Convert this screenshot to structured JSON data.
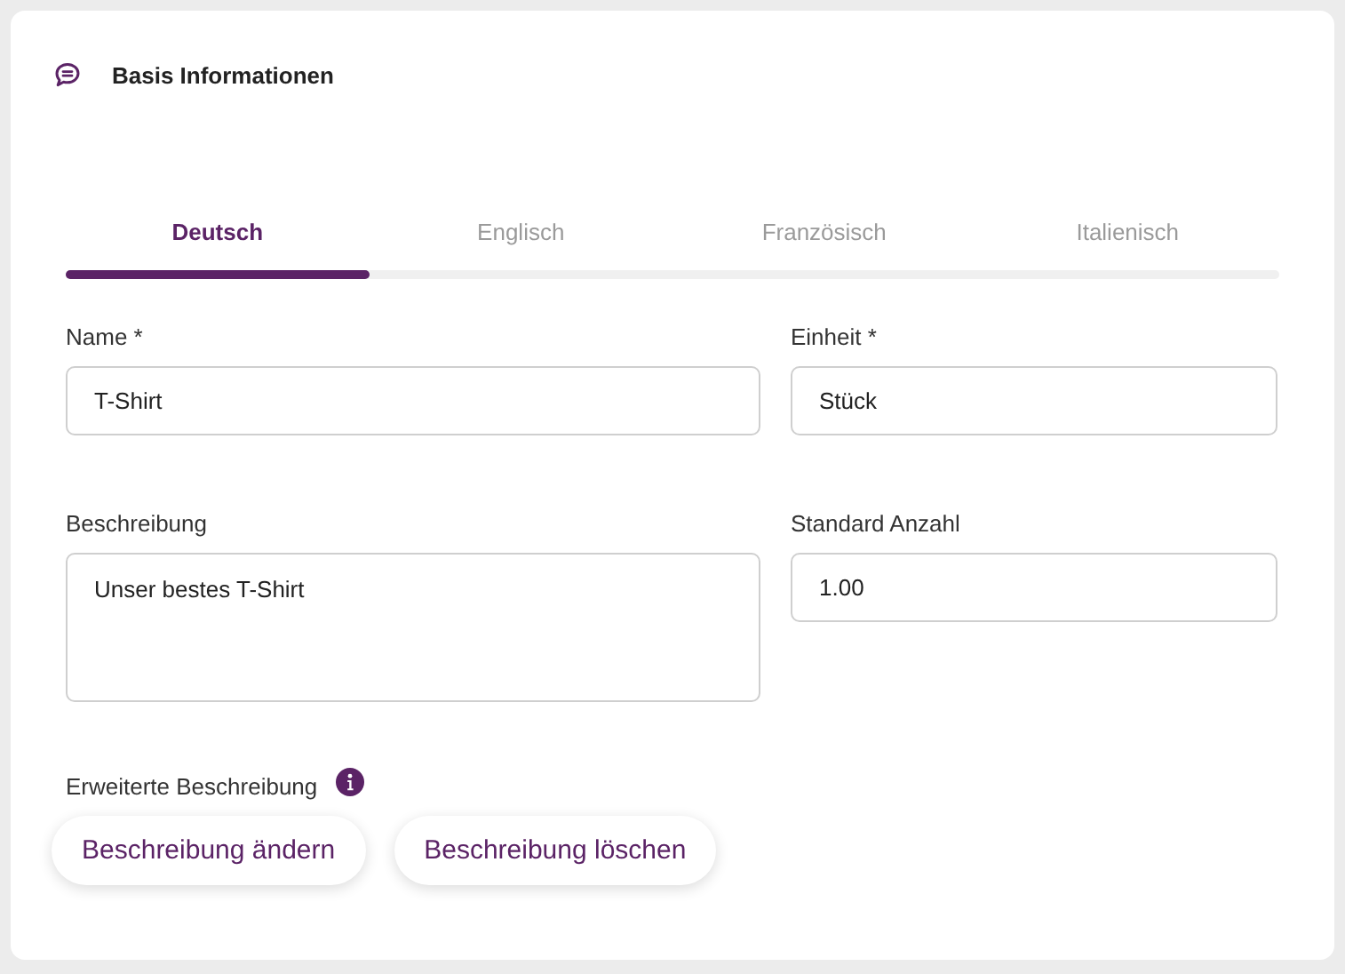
{
  "header": {
    "title": "Basis Informationen"
  },
  "tabs": [
    {
      "label": "Deutsch",
      "selected": true
    },
    {
      "label": "Englisch",
      "selected": false
    },
    {
      "label": "Französisch",
      "selected": false
    },
    {
      "label": "Italienisch",
      "selected": false
    }
  ],
  "fields": [
    {
      "label": "Name *",
      "value": "T-Shirt",
      "kind": "input"
    },
    {
      "label": "Einheit *",
      "value": "Stück",
      "kind": "input"
    },
    {
      "label": "Beschreibung",
      "value": "Unser bestes T-Shirt",
      "kind": "textarea"
    },
    {
      "label": "Standard Anzahl",
      "value": "1.00",
      "kind": "input"
    }
  ],
  "extended": {
    "label": "Erweiterte Beschreibung",
    "buttons": [
      "Beschreibung ändern",
      "Beschreibung löschen"
    ]
  }
}
